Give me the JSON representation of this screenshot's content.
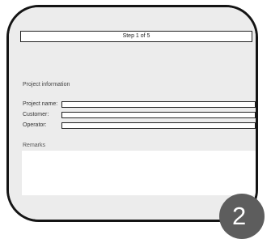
{
  "header": {
    "step": "Step 1 of 5"
  },
  "section": {
    "title": "Project information"
  },
  "fields": [
    {
      "label": "Project name:",
      "value": ""
    },
    {
      "label": "Customer:",
      "value": ""
    },
    {
      "label": "Operator:",
      "value": ""
    }
  ],
  "remarks": {
    "label": "Remarks",
    "value": ""
  },
  "badge": {
    "number": "2"
  },
  "colors": {
    "device_frame": "#141414",
    "screen": "#ececec",
    "badge": "#5d5d5d"
  }
}
